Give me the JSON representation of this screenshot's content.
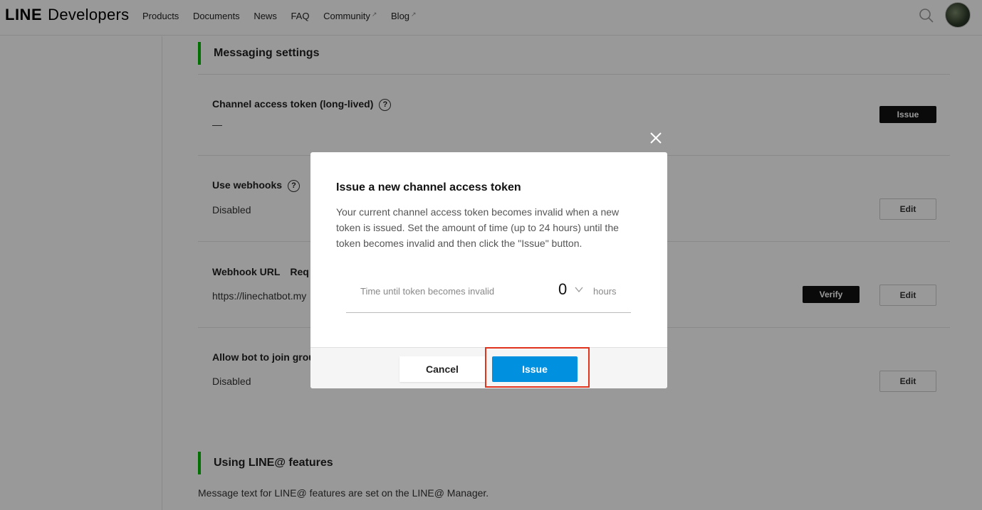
{
  "header": {
    "logo_line": "LINE",
    "logo_dev": "Developers",
    "nav": [
      "Products",
      "Documents",
      "News",
      "FAQ",
      "Community",
      "Blog"
    ]
  },
  "messaging": {
    "title": "Messaging settings",
    "token_label": "Channel access token (long-lived)",
    "token_value": "—",
    "issue_label": "Issue",
    "webhooks_label": "Use webhooks",
    "webhooks_value": "Disabled",
    "edit_label": "Edit",
    "webhook_url_label": "Webhook URL",
    "webhook_url_req": "Req",
    "webhook_url_value": "https://linechatbot.my",
    "verify_label": "Verify",
    "allow_bot_label": "Allow bot to join grou",
    "allow_bot_value": "Disabled"
  },
  "line_at": {
    "title": "Using LINE@ features",
    "note": "Message text for LINE@ features are set on the LINE@ Manager."
  },
  "modal": {
    "title": "Issue a new channel access token",
    "body": "Your current channel access token becomes invalid when a new token is issued. Set the amount of time (up to 24 hours) until the token becomes invalid and then click the \"Issue\" button.",
    "field_label": "Time until token becomes invalid",
    "field_value": "0",
    "field_unit": "hours",
    "cancel_label": "Cancel",
    "issue_label": "Issue"
  },
  "colors": {
    "accent_green": "#00b900",
    "issue_blue": "#0090e0",
    "highlight_red": "#e0341e"
  }
}
